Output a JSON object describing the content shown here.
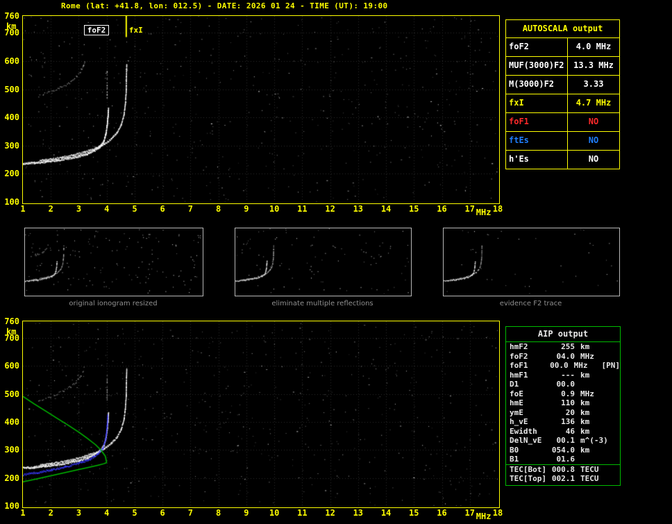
{
  "title": "Rome (lat: +41.8, lon: 012.5) - DATE: 2026 01 24 - TIME (UT): 19:00",
  "colors": {
    "accent_yellow": "#ffff00",
    "profile_green": "#00bb00",
    "restored_blue": "#3a3aff",
    "no_red": "#ff2a2a",
    "no_blue": "#1f7fff",
    "caption_gray": "#8f8f8f"
  },
  "axes": {
    "x_unit": "MHz",
    "y_unit": "km",
    "x_ticks": [
      "1",
      "2",
      "3",
      "4",
      "5",
      "6",
      "7",
      "8",
      "9",
      "10",
      "11",
      "12",
      "13",
      "14",
      "15",
      "16",
      "17",
      "18"
    ],
    "y_ticks": [
      "760",
      "700",
      "600",
      "500",
      "400",
      "300",
      "200",
      "100"
    ]
  },
  "top_ionogram": {
    "foF2_label": "foF2",
    "fxI_label": "fxI"
  },
  "autoscala": {
    "header": "AUTOSCALA output",
    "rows": [
      {
        "param": "foF2",
        "value": "4.0 MHz",
        "color": "white"
      },
      {
        "param": "MUF(3000)F2",
        "value": "13.3 MHz",
        "color": "white"
      },
      {
        "param": "M(3000)F2",
        "value": "3.33",
        "color": "white"
      },
      {
        "param": "fxI",
        "value": "4.7 MHz",
        "color": "yellow"
      },
      {
        "param": "foF1",
        "value": "NO",
        "color": "red"
      },
      {
        "param": "ftEs",
        "value": "NO",
        "color": "blue"
      },
      {
        "param": "h'Es",
        "value": "NO",
        "color": "white"
      }
    ]
  },
  "thumbnails": [
    {
      "caption": "original ionogram resized",
      "noise": 150
    },
    {
      "caption": "eliminate multiple reflections",
      "noise": 95
    },
    {
      "caption": "evidence F2 trace",
      "noise": 40
    }
  ],
  "aip": {
    "header": "AIP output",
    "rows": [
      {
        "param": "hmF2",
        "value": "255",
        "unit": "km",
        "extra": ""
      },
      {
        "param": "foF2",
        "value": "04.0",
        "unit": "MHz",
        "extra": ""
      },
      {
        "param": "foF1",
        "value": "00.0",
        "unit": "MHz",
        "extra": "[PN]"
      },
      {
        "param": "hmF1",
        "value": "---",
        "unit": "km",
        "extra": ""
      },
      {
        "param": "D1",
        "value": "00.0",
        "unit": "",
        "extra": ""
      },
      {
        "param": "foE",
        "value": "0.9",
        "unit": "MHz",
        "extra": ""
      },
      {
        "param": "hmE",
        "value": "110",
        "unit": "km",
        "extra": ""
      },
      {
        "param": "ymE",
        "value": "20",
        "unit": "km",
        "extra": ""
      },
      {
        "param": "h_vE",
        "value": "136",
        "unit": "km",
        "extra": ""
      },
      {
        "param": "Ewidth",
        "value": "46",
        "unit": "km",
        "extra": ""
      },
      {
        "param": "DelN_vE",
        "value": "00.1",
        "unit": "m^(-3)",
        "extra": ""
      },
      {
        "param": "B0",
        "value": "054.0",
        "unit": "km",
        "extra": ""
      },
      {
        "param": "B1",
        "value": "01.6",
        "unit": "",
        "extra": ""
      },
      {
        "param": "TEC[Bot]",
        "value": "000.8",
        "unit": "TECU",
        "extra": "",
        "sep_above": true
      },
      {
        "param": "TEC[Top]",
        "value": "002.1",
        "unit": "TECU",
        "extra": ""
      }
    ]
  },
  "chart_data": {
    "type": "scatter",
    "title": "Ionogram: virtual height (km) vs frequency (MHz)",
    "xlabel": "MHz",
    "ylabel": "km",
    "xlim": [
      1,
      18
    ],
    "ylim": [
      100,
      760
    ],
    "markers": {
      "foF2_mhz": 4.0,
      "fxI_mhz": 4.7
    },
    "series": {
      "o_trace": [
        [
          1.0,
          237
        ],
        [
          1.4,
          240
        ],
        [
          1.8,
          244
        ],
        [
          2.2,
          249
        ],
        [
          2.6,
          256
        ],
        [
          3.0,
          264
        ],
        [
          3.3,
          273
        ],
        [
          3.55,
          284
        ],
        [
          3.75,
          298
        ],
        [
          3.88,
          316
        ],
        [
          3.95,
          340
        ],
        [
          4.0,
          372
        ],
        [
          4.03,
          405
        ],
        [
          4.05,
          432
        ]
      ],
      "x_trace": [
        [
          1.6,
          248
        ],
        [
          2.0,
          253
        ],
        [
          2.4,
          260
        ],
        [
          2.8,
          268
        ],
        [
          3.2,
          279
        ],
        [
          3.6,
          292
        ],
        [
          3.9,
          307
        ],
        [
          4.15,
          325
        ],
        [
          4.35,
          347
        ],
        [
          4.5,
          374
        ],
        [
          4.6,
          408
        ],
        [
          4.65,
          448
        ],
        [
          4.68,
          492
        ],
        [
          4.7,
          590
        ]
      ],
      "second_hop_echo": [
        [
          1.55,
          478
        ],
        [
          1.85,
          488
        ],
        [
          2.15,
          499
        ],
        [
          2.45,
          512
        ],
        [
          2.7,
          527
        ],
        [
          2.9,
          545
        ],
        [
          3.05,
          565
        ],
        [
          3.15,
          586
        ],
        [
          3.2,
          602
        ]
      ],
      "asymptote_echo": [
        [
          4.0,
          470
        ],
        [
          4.0,
          565
        ]
      ],
      "restored_trace": [
        [
          1.0,
          213
        ],
        [
          1.5,
          221
        ],
        [
          2.0,
          230
        ],
        [
          2.5,
          241
        ],
        [
          3.0,
          254
        ],
        [
          3.4,
          269
        ],
        [
          3.65,
          285
        ],
        [
          3.85,
          308
        ],
        [
          3.95,
          340
        ],
        [
          4.0,
          385
        ],
        [
          4.02,
          425
        ]
      ],
      "profile_topside": [
        [
          1.0,
          492
        ],
        [
          1.4,
          465
        ],
        [
          1.8,
          440
        ],
        [
          2.2,
          415
        ],
        [
          2.6,
          390
        ],
        [
          3.0,
          364
        ],
        [
          3.3,
          342
        ],
        [
          3.6,
          319
        ],
        [
          3.8,
          299
        ],
        [
          3.95,
          278
        ],
        [
          4.0,
          255
        ]
      ],
      "profile_bottomside": [
        [
          1.0,
          186
        ],
        [
          1.5,
          197
        ],
        [
          2.0,
          208
        ],
        [
          2.5,
          219
        ],
        [
          3.0,
          230
        ],
        [
          3.4,
          239
        ],
        [
          3.7,
          246
        ],
        [
          3.9,
          251
        ],
        [
          4.0,
          255
        ]
      ]
    }
  }
}
